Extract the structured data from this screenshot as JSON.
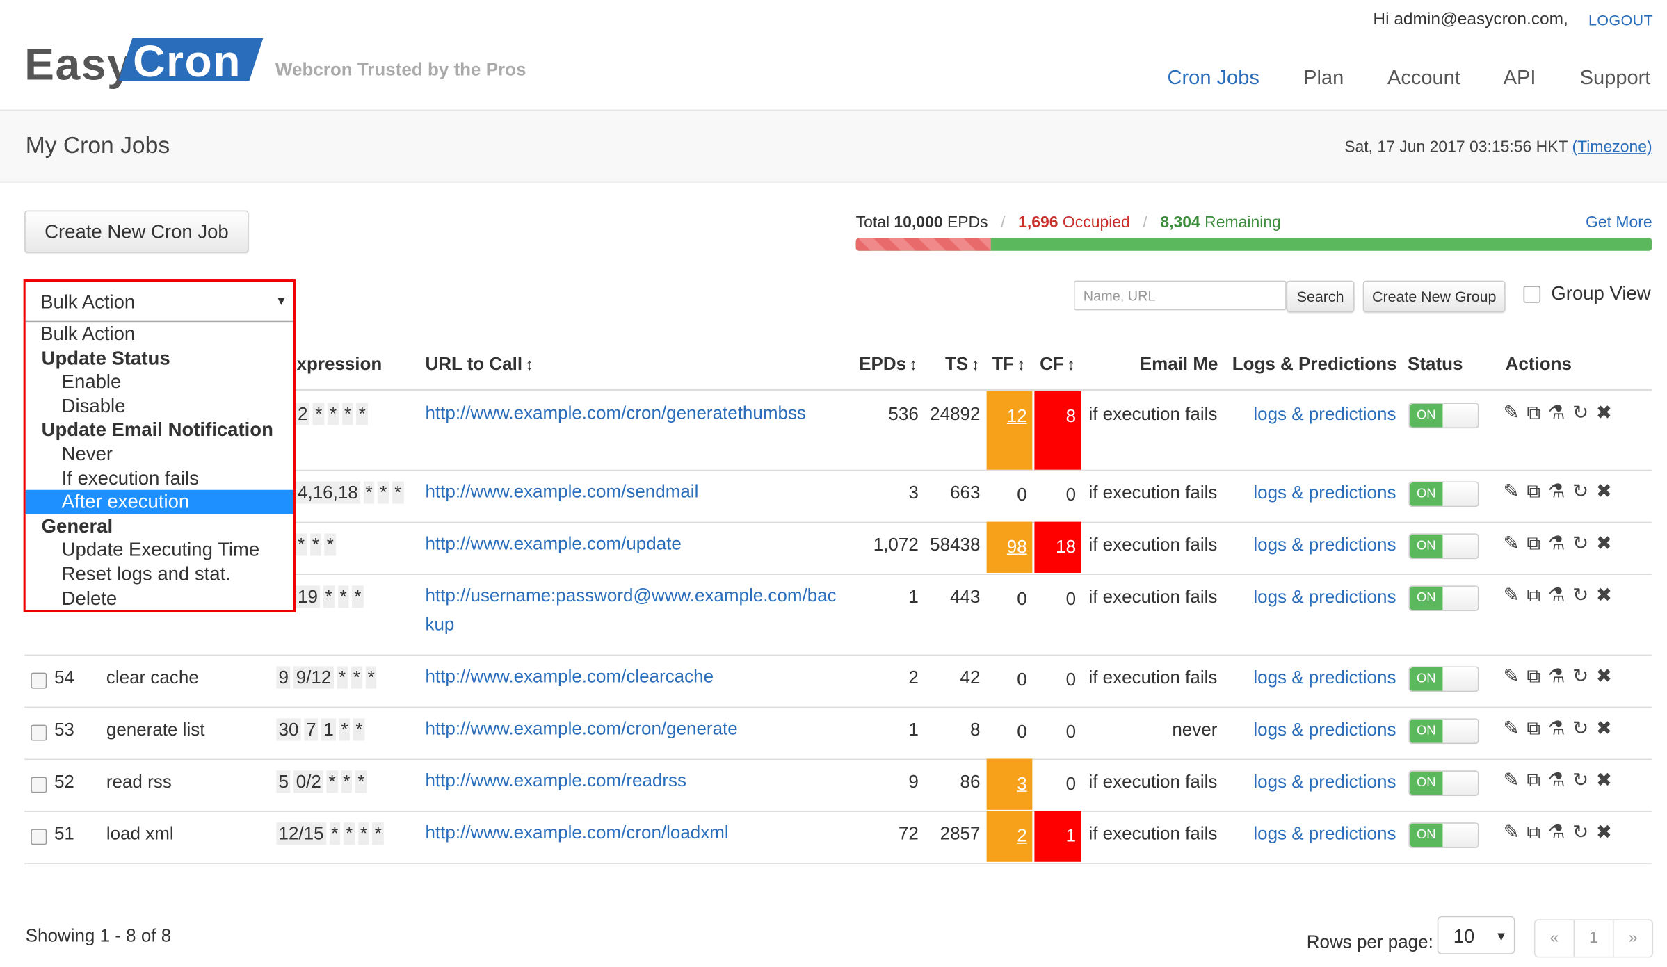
{
  "header": {
    "greeting": "Hi admin@easycron.com,",
    "logout": "LOGOUT",
    "logo_easy": "Easy",
    "logo_cron": "Cron",
    "tagline": "Webcron Trusted by the Pros",
    "nav": [
      "Cron Jobs",
      "Plan",
      "Account",
      "API",
      "Support"
    ]
  },
  "title_band": {
    "title": "My Cron Jobs",
    "datetime": "Sat, 17 Jun 2017 03:15:56 HKT",
    "timezone_link": "(Timezone)"
  },
  "toolbar": {
    "create_button": "Create New Cron Job",
    "search_placeholder": "Name, URL",
    "search_button": "Search",
    "create_group_button": "Create New Group",
    "group_view_label": "Group View"
  },
  "quota": {
    "total_prefix": "Total",
    "total_value": "10,000",
    "total_unit": "EPDs",
    "occupied_value": "1,696",
    "occupied_label": "Occupied",
    "remaining_value": "8,304",
    "remaining_label": "Remaining",
    "occupied_fraction": 0.1696,
    "get_more": "Get More"
  },
  "bulk_action": {
    "selected": "Bulk Action",
    "options": [
      {
        "label": "Bulk Action",
        "kind": "option0"
      },
      {
        "label": "Update Status",
        "kind": "group"
      },
      {
        "label": "Enable",
        "kind": "option"
      },
      {
        "label": "Disable",
        "kind": "option"
      },
      {
        "label": "Update Email Notification",
        "kind": "group"
      },
      {
        "label": "Never",
        "kind": "option"
      },
      {
        "label": "If execution fails",
        "kind": "option"
      },
      {
        "label": "After execution",
        "kind": "option",
        "highlighted": true
      },
      {
        "label": "General",
        "kind": "group"
      },
      {
        "label": "Update Executing Time",
        "kind": "option"
      },
      {
        "label": "Reset logs and stat.",
        "kind": "option"
      },
      {
        "label": "Delete",
        "kind": "option"
      }
    ]
  },
  "table": {
    "headers": {
      "expression": "xpression",
      "url": "URL to Call",
      "epds": "EPDs",
      "ts": "TS",
      "tf": "TF",
      "cf": "CF",
      "email": "Email Me",
      "logs": "Logs & Predictions",
      "status": "Status",
      "actions": "Actions"
    },
    "sort_icon": "↕",
    "rows": [
      {
        "id": "",
        "name": "",
        "expr": [
          "2",
          "*",
          "*",
          "*",
          "*"
        ],
        "url": "http://www.example.com/cron/generatethumbss",
        "epds": "536",
        "ts": "24892",
        "tf": "12",
        "tf_hl": true,
        "cf": "8",
        "cf_hl": true,
        "email": "if execution fails",
        "logs": "logs & predictions",
        "status": "ON"
      },
      {
        "id": "",
        "name": "",
        "expr": [
          "4,16,18",
          "*",
          "*",
          "*"
        ],
        "url": "http://www.example.com/sendmail",
        "epds": "3",
        "ts": "663",
        "tf": "0",
        "tf_hl": false,
        "cf": "0",
        "cf_hl": false,
        "email": "if execution fails",
        "logs": "logs & predictions",
        "status": "ON"
      },
      {
        "id": "",
        "name": "",
        "expr": [
          "*",
          "*",
          "*"
        ],
        "url": "http://www.example.com/update",
        "epds": "1,072",
        "ts": "58438",
        "tf": "98",
        "tf_hl": true,
        "cf": "18",
        "cf_hl": true,
        "email": "if execution fails",
        "logs": "logs & predictions",
        "status": "ON"
      },
      {
        "id": "",
        "name": "",
        "expr": [
          "19",
          "*",
          "*",
          "*"
        ],
        "url": "http://username:password@www.example.com/backup",
        "epds": "1",
        "ts": "443",
        "tf": "0",
        "tf_hl": false,
        "cf": "0",
        "cf_hl": false,
        "email": "if execution fails",
        "logs": "logs & predictions",
        "status": "ON"
      },
      {
        "id": "54",
        "name": "clear cache",
        "expr": [
          "9",
          "9/12",
          "*",
          "*",
          "*"
        ],
        "url": "http://www.example.com/clearcache",
        "epds": "2",
        "ts": "42",
        "tf": "0",
        "tf_hl": false,
        "cf": "0",
        "cf_hl": false,
        "email": "if execution fails",
        "logs": "logs & predictions",
        "status": "ON"
      },
      {
        "id": "53",
        "name": "generate list",
        "expr": [
          "30",
          "7",
          "1",
          "*",
          "*"
        ],
        "url": "http://www.example.com/cron/generate",
        "epds": "1",
        "ts": "8",
        "tf": "0",
        "tf_hl": false,
        "cf": "0",
        "cf_hl": false,
        "email": "never",
        "logs": "logs & predictions",
        "status": "ON"
      },
      {
        "id": "52",
        "name": "read rss",
        "expr": [
          "5",
          "0/2",
          "*",
          "*",
          "*"
        ],
        "url": "http://www.example.com/readrss",
        "epds": "9",
        "ts": "86",
        "tf": "3",
        "tf_hl": true,
        "cf": "0",
        "cf_hl": false,
        "email": "if execution fails",
        "logs": "logs & predictions",
        "status": "ON"
      },
      {
        "id": "51",
        "name": "load xml",
        "expr": [
          "12/15",
          "*",
          "*",
          "*",
          "*"
        ],
        "url": "http://www.example.com/cron/loadxml",
        "epds": "72",
        "ts": "2857",
        "tf": "2",
        "tf_hl": true,
        "cf": "1",
        "cf_hl": true,
        "email": "if execution fails",
        "logs": "logs & predictions",
        "status": "ON"
      }
    ],
    "action_icons": [
      "edit-icon",
      "copy-icon",
      "test-flask-icon",
      "reset-icon",
      "delete-icon"
    ]
  },
  "footer": {
    "showing": "Showing 1 - 8 of 8",
    "rows_per_page_label": "Rows per page:",
    "rows_per_page_value": "10",
    "pager": [
      "«",
      "1",
      "»"
    ]
  }
}
